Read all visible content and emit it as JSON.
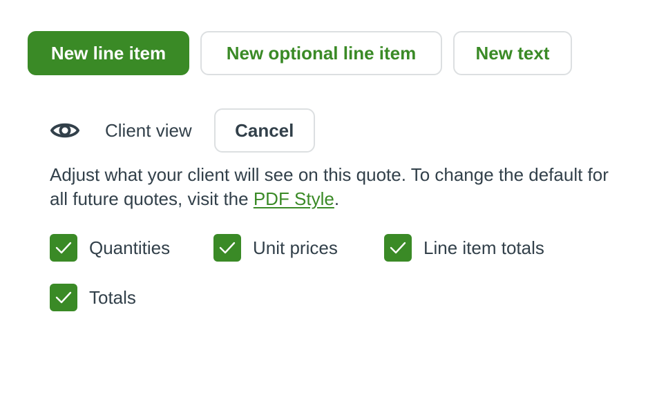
{
  "toolbar": {
    "new_line_item": "New line item",
    "new_optional_line_item": "New optional line item",
    "new_text": "New text"
  },
  "client_view": {
    "icon": "eye-icon",
    "label": "Client view",
    "cancel": "Cancel"
  },
  "description": {
    "text_before": "Adjust what your client will see on this quote. To change the default for all future quotes, visit the ",
    "link_text": "PDF Style",
    "text_after": "."
  },
  "options": [
    {
      "label": "Quantities",
      "checked": true
    },
    {
      "label": "Unit prices",
      "checked": true
    },
    {
      "label": "Line item totals",
      "checked": true
    },
    {
      "label": "Totals",
      "checked": true
    }
  ],
  "colors": {
    "accent": "#3a8a26",
    "text": "#32404a",
    "border": "#dcdfe1"
  }
}
